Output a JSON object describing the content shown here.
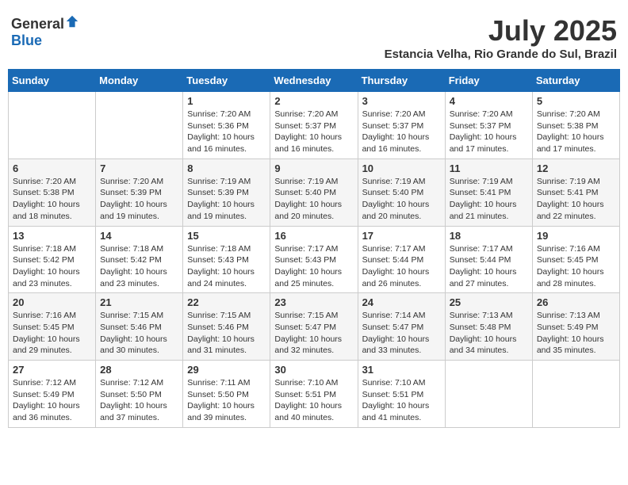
{
  "header": {
    "logo_general": "General",
    "logo_blue": "Blue",
    "month_title": "July 2025",
    "subtitle": "Estancia Velha, Rio Grande do Sul, Brazil"
  },
  "days_of_week": [
    "Sunday",
    "Monday",
    "Tuesday",
    "Wednesday",
    "Thursday",
    "Friday",
    "Saturday"
  ],
  "weeks": [
    [
      {
        "day": "",
        "info": ""
      },
      {
        "day": "",
        "info": ""
      },
      {
        "day": "1",
        "info": "Sunrise: 7:20 AM\nSunset: 5:36 PM\nDaylight: 10 hours and 16 minutes."
      },
      {
        "day": "2",
        "info": "Sunrise: 7:20 AM\nSunset: 5:37 PM\nDaylight: 10 hours and 16 minutes."
      },
      {
        "day": "3",
        "info": "Sunrise: 7:20 AM\nSunset: 5:37 PM\nDaylight: 10 hours and 16 minutes."
      },
      {
        "day": "4",
        "info": "Sunrise: 7:20 AM\nSunset: 5:37 PM\nDaylight: 10 hours and 17 minutes."
      },
      {
        "day": "5",
        "info": "Sunrise: 7:20 AM\nSunset: 5:38 PM\nDaylight: 10 hours and 17 minutes."
      }
    ],
    [
      {
        "day": "6",
        "info": "Sunrise: 7:20 AM\nSunset: 5:38 PM\nDaylight: 10 hours and 18 minutes."
      },
      {
        "day": "7",
        "info": "Sunrise: 7:20 AM\nSunset: 5:39 PM\nDaylight: 10 hours and 19 minutes."
      },
      {
        "day": "8",
        "info": "Sunrise: 7:19 AM\nSunset: 5:39 PM\nDaylight: 10 hours and 19 minutes."
      },
      {
        "day": "9",
        "info": "Sunrise: 7:19 AM\nSunset: 5:40 PM\nDaylight: 10 hours and 20 minutes."
      },
      {
        "day": "10",
        "info": "Sunrise: 7:19 AM\nSunset: 5:40 PM\nDaylight: 10 hours and 20 minutes."
      },
      {
        "day": "11",
        "info": "Sunrise: 7:19 AM\nSunset: 5:41 PM\nDaylight: 10 hours and 21 minutes."
      },
      {
        "day": "12",
        "info": "Sunrise: 7:19 AM\nSunset: 5:41 PM\nDaylight: 10 hours and 22 minutes."
      }
    ],
    [
      {
        "day": "13",
        "info": "Sunrise: 7:18 AM\nSunset: 5:42 PM\nDaylight: 10 hours and 23 minutes."
      },
      {
        "day": "14",
        "info": "Sunrise: 7:18 AM\nSunset: 5:42 PM\nDaylight: 10 hours and 23 minutes."
      },
      {
        "day": "15",
        "info": "Sunrise: 7:18 AM\nSunset: 5:43 PM\nDaylight: 10 hours and 24 minutes."
      },
      {
        "day": "16",
        "info": "Sunrise: 7:17 AM\nSunset: 5:43 PM\nDaylight: 10 hours and 25 minutes."
      },
      {
        "day": "17",
        "info": "Sunrise: 7:17 AM\nSunset: 5:44 PM\nDaylight: 10 hours and 26 minutes."
      },
      {
        "day": "18",
        "info": "Sunrise: 7:17 AM\nSunset: 5:44 PM\nDaylight: 10 hours and 27 minutes."
      },
      {
        "day": "19",
        "info": "Sunrise: 7:16 AM\nSunset: 5:45 PM\nDaylight: 10 hours and 28 minutes."
      }
    ],
    [
      {
        "day": "20",
        "info": "Sunrise: 7:16 AM\nSunset: 5:45 PM\nDaylight: 10 hours and 29 minutes."
      },
      {
        "day": "21",
        "info": "Sunrise: 7:15 AM\nSunset: 5:46 PM\nDaylight: 10 hours and 30 minutes."
      },
      {
        "day": "22",
        "info": "Sunrise: 7:15 AM\nSunset: 5:46 PM\nDaylight: 10 hours and 31 minutes."
      },
      {
        "day": "23",
        "info": "Sunrise: 7:15 AM\nSunset: 5:47 PM\nDaylight: 10 hours and 32 minutes."
      },
      {
        "day": "24",
        "info": "Sunrise: 7:14 AM\nSunset: 5:47 PM\nDaylight: 10 hours and 33 minutes."
      },
      {
        "day": "25",
        "info": "Sunrise: 7:13 AM\nSunset: 5:48 PM\nDaylight: 10 hours and 34 minutes."
      },
      {
        "day": "26",
        "info": "Sunrise: 7:13 AM\nSunset: 5:49 PM\nDaylight: 10 hours and 35 minutes."
      }
    ],
    [
      {
        "day": "27",
        "info": "Sunrise: 7:12 AM\nSunset: 5:49 PM\nDaylight: 10 hours and 36 minutes."
      },
      {
        "day": "28",
        "info": "Sunrise: 7:12 AM\nSunset: 5:50 PM\nDaylight: 10 hours and 37 minutes."
      },
      {
        "day": "29",
        "info": "Sunrise: 7:11 AM\nSunset: 5:50 PM\nDaylight: 10 hours and 39 minutes."
      },
      {
        "day": "30",
        "info": "Sunrise: 7:10 AM\nSunset: 5:51 PM\nDaylight: 10 hours and 40 minutes."
      },
      {
        "day": "31",
        "info": "Sunrise: 7:10 AM\nSunset: 5:51 PM\nDaylight: 10 hours and 41 minutes."
      },
      {
        "day": "",
        "info": ""
      },
      {
        "day": "",
        "info": ""
      }
    ]
  ]
}
